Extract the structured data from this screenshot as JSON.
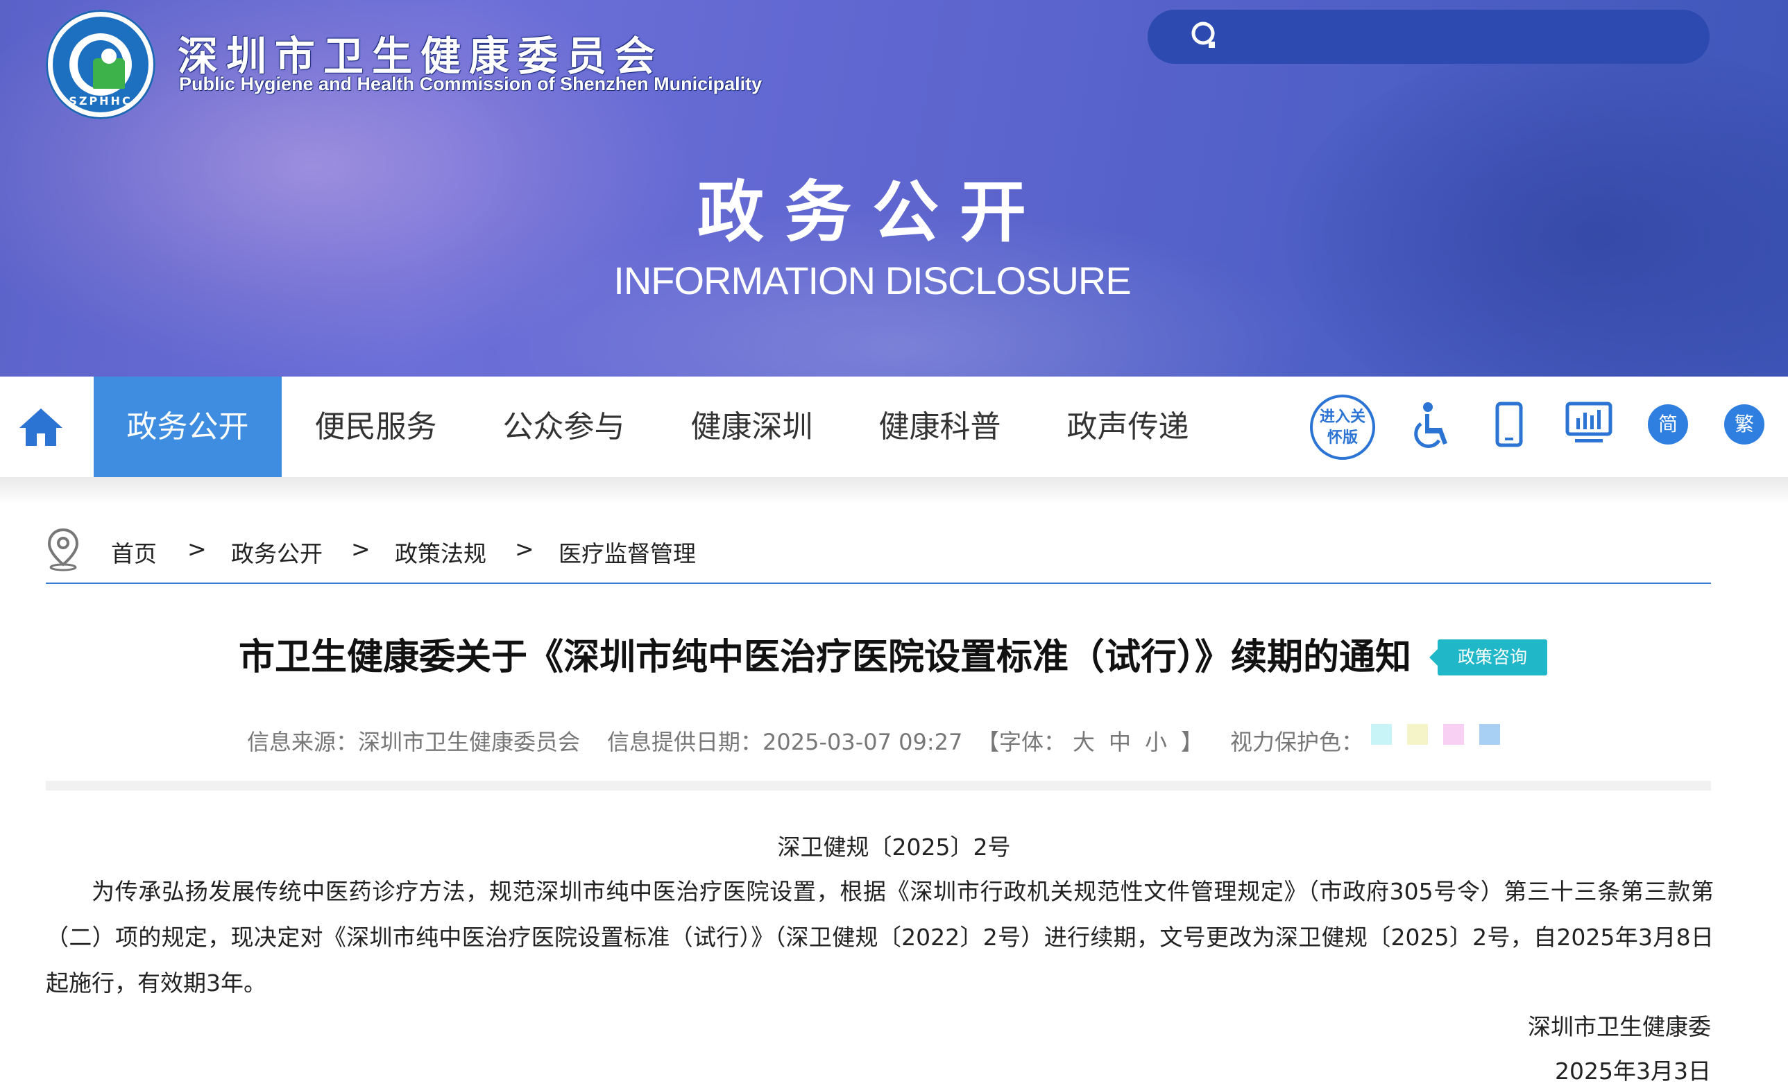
{
  "header": {
    "site_name_cn": "深圳市卫生健康委员会",
    "site_name_en": "Public Hygiene and Health Commission of Shenzhen Municipality",
    "logo_text": "SZPHHC",
    "search_placeholder": ""
  },
  "banner": {
    "title_cn": "政务公开",
    "title_en": "INFORMATION DISCLOSURE"
  },
  "nav": {
    "items": [
      "政务公开",
      "便民服务",
      "公众参与",
      "健康深圳",
      "健康科普",
      "政声传递"
    ],
    "active_index": 0,
    "tools": {
      "care_mode": "进入关怀版",
      "simplified": "简",
      "traditional": "繁"
    }
  },
  "breadcrumb": [
    "首页",
    "政务公开",
    "政策法规",
    "医疗监督管理"
  ],
  "breadcrumb_separator": ">",
  "article": {
    "title": "市卫生健康委关于《深圳市纯中医治疗医院设置标准（试行）》续期的通知",
    "badge": "政策咨询",
    "meta": {
      "source": "信息来源：深圳市卫生健康委员会",
      "date": "信息提供日期：2025-03-07 09:27",
      "font_size_label": "【字体：",
      "font_large": "大",
      "font_medium": "中",
      "font_small": "小",
      "font_close": "】",
      "eye_care_label": "视力保护色："
    },
    "eye_care_colors": [
      "#c8f4f8",
      "#f4f4c8",
      "#f8d0f4",
      "#a8cff4"
    ],
    "doc_number": "深卫健规〔2025〕2号",
    "body": "为传承弘扬发展传统中医药诊疗方法，规范深圳市纯中医治疗医院设置，根据《深圳市行政机关规范性文件管理规定》（市政府305号令）第三十三条第三款第（二）项的规定，现决定对《深圳市纯中医治疗医院设置标准（试行）》（深卫健规〔2022〕2号）进行续期，文号更改为深卫健规〔2025〕2号，自2025年3月8日起施行，有效期3年。",
    "signature": "深圳市卫生健康委",
    "sign_date": "2025年3月3日"
  },
  "colors": {
    "accent": "#3e8de0",
    "banner": "#5a62c8",
    "badge": "#20b7c8"
  }
}
